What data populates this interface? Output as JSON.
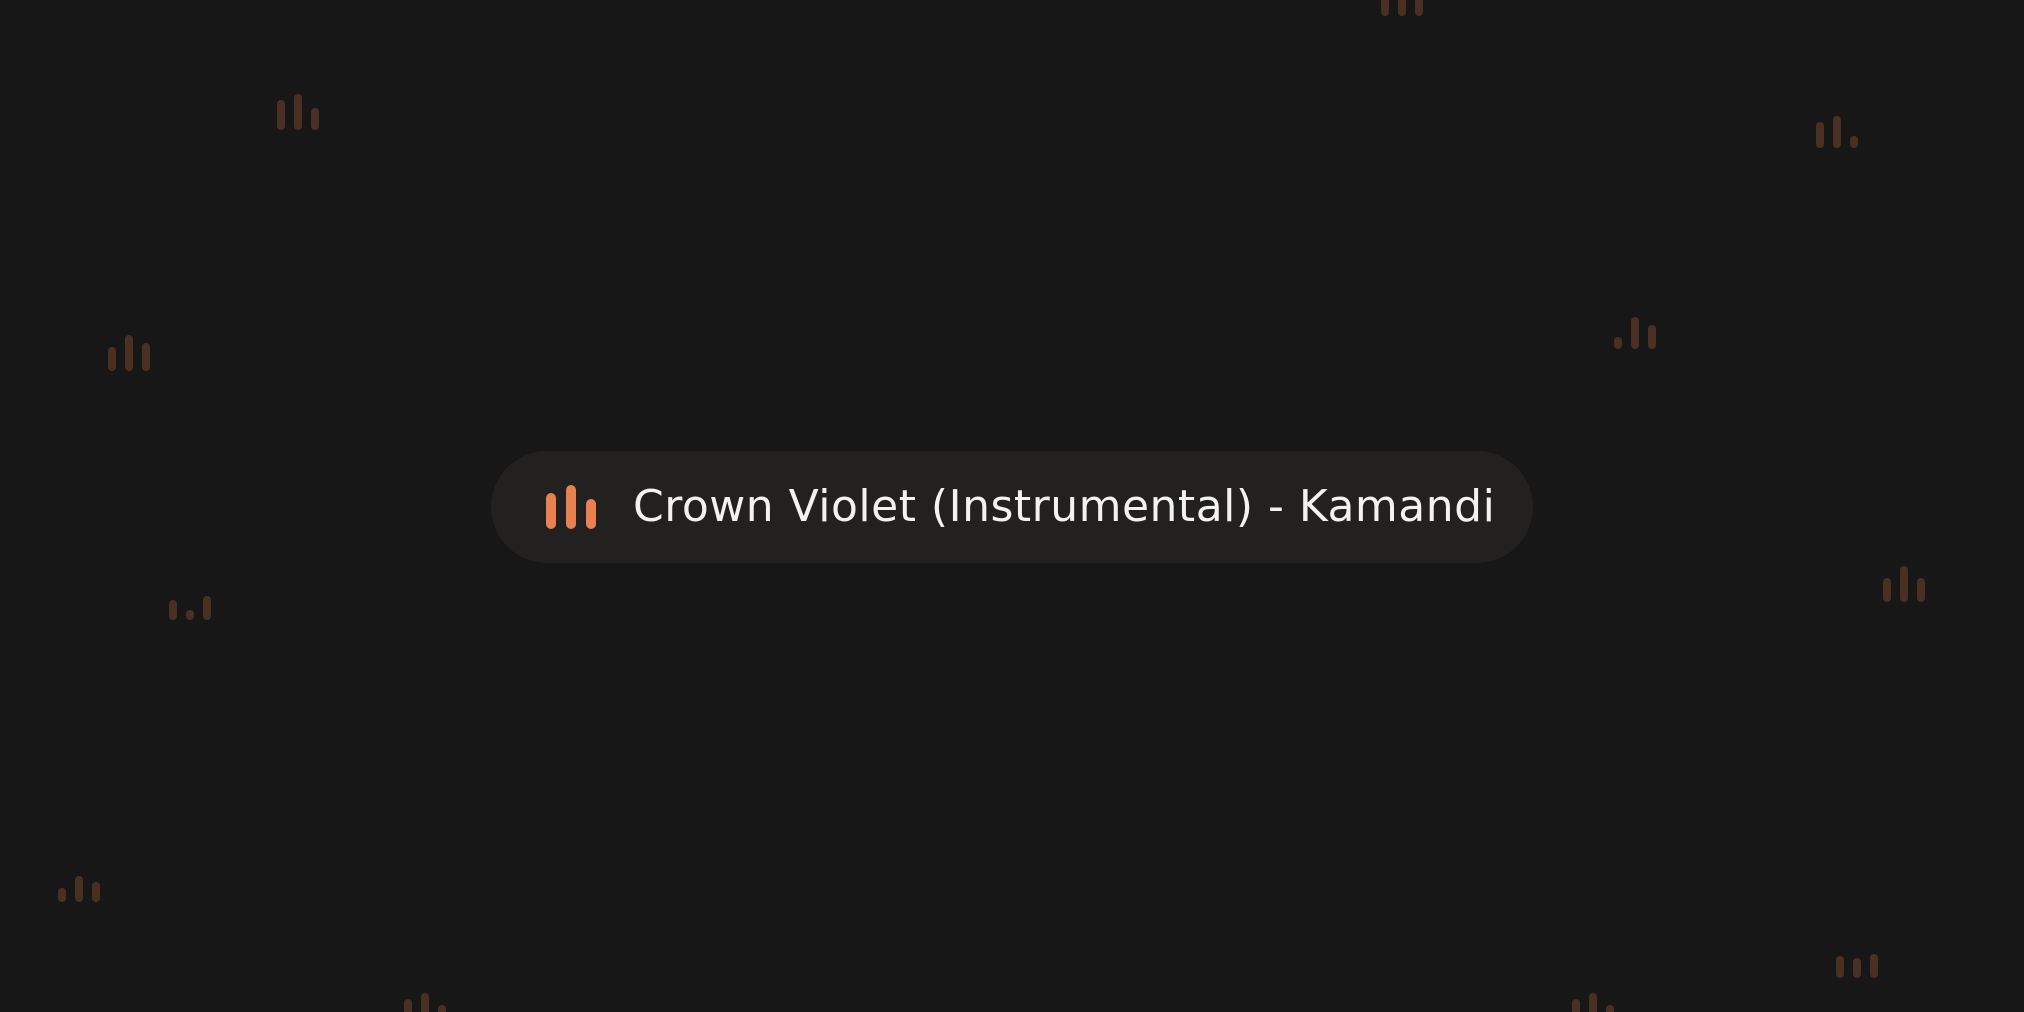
{
  "now_playing": {
    "track_title": "Crown Violet (Instrumental) - Kamandi",
    "icon": "equalizer-bars-icon"
  },
  "background": {
    "icon": "equalizer-bars-icon"
  },
  "colors": {
    "background": "#171717",
    "pill": "#222120",
    "accent": "#e8804f",
    "background_icon": "#4a2f23",
    "text": "#f2f2f2"
  }
}
